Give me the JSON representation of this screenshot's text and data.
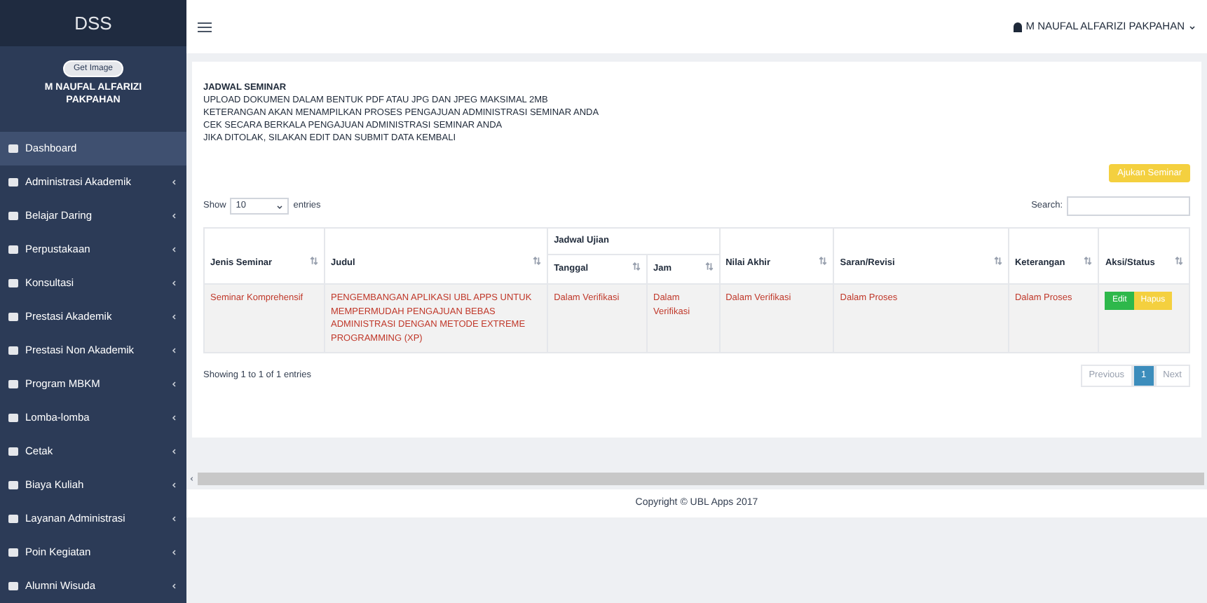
{
  "sidebar": {
    "brand": "DSS",
    "avatar_label": "Get Image",
    "user_name": "M NAUFAL ALFARIZI PAKPAHAN",
    "items": [
      {
        "label": "Dashboard",
        "selected": true,
        "has_submenu": false
      },
      {
        "label": "Administrasi Akademik",
        "selected": false,
        "has_submenu": true
      },
      {
        "label": "Belajar Daring",
        "selected": false,
        "has_submenu": true
      },
      {
        "label": "Perpustakaan",
        "selected": false,
        "has_submenu": true
      },
      {
        "label": "Konsultasi",
        "selected": false,
        "has_submenu": true
      },
      {
        "label": "Prestasi Akademik",
        "selected": false,
        "has_submenu": true
      },
      {
        "label": "Prestasi Non Akademik",
        "selected": false,
        "has_submenu": true
      },
      {
        "label": "Program MBKM",
        "selected": false,
        "has_submenu": true
      },
      {
        "label": "Lomba-lomba",
        "selected": false,
        "has_submenu": true
      },
      {
        "label": "Cetak",
        "selected": false,
        "has_submenu": true
      },
      {
        "label": "Biaya Kuliah",
        "selected": false,
        "has_submenu": true
      },
      {
        "label": "Layanan Administrasi",
        "selected": false,
        "has_submenu": true
      },
      {
        "label": "Poin Kegiatan",
        "selected": false,
        "has_submenu": true
      },
      {
        "label": "Alumni Wisuda",
        "selected": false,
        "has_submenu": true
      }
    ]
  },
  "topbar": {
    "user": "M NAUFAL ALFARIZI PAKPAHAN"
  },
  "notice": [
    "JADWAL SEMINAR",
    "UPLOAD DOKUMEN DALAM BENTUK PDF ATAU JPG DAN JPEG MAKSIMAL 2MB",
    "KETERANGAN AKAN MENAMPILKAN PROSES PENGAJUAN ADMINISTRASI SEMINAR ANDA",
    "CEK SECARA BERKALA PENGAJUAN ADMINISTRASI SEMINAR ANDA",
    "JIKA DITOLAK, SILAKAN EDIT DAN SUBMIT DATA KEMBALI"
  ],
  "add_button": "Ajukan Seminar",
  "table_controls": {
    "show": "Show",
    "page_size": "10",
    "entries": "entries",
    "search": "Search:"
  },
  "table": {
    "group_header": "Jadwal Ujian",
    "columns": [
      "Jenis Seminar",
      "Judul",
      "Tanggal",
      "Jam",
      "Nilai Akhir",
      "Saran/Revisi",
      "Keterangan",
      "Aksi/Status"
    ],
    "rows": [
      {
        "cells": [
          "Seminar Komprehensif",
          "PENGEMBANGAN APLIKASI UBL APPS UNTUK MEMPERMUDAH PENGAJUAN BEBAS ADMINISTRASI DENGAN METODE EXTREME PROGRAMMING (XP)",
          "Dalam Verifikasi",
          "Dalam Verifikasi",
          "Dalam Verifikasi",
          "Dalam Proses",
          "Dalam Proses"
        ],
        "actions": [
          "Edit",
          "Hapus"
        ]
      }
    ]
  },
  "info": "Showing 1 to 1 of 1 entries",
  "pagination": [
    {
      "label": "Previous",
      "selected": false
    },
    {
      "label": "1",
      "selected": true
    },
    {
      "label": "Next",
      "selected": false
    }
  ],
  "footer": "Copyright © UBL Apps 2017"
}
